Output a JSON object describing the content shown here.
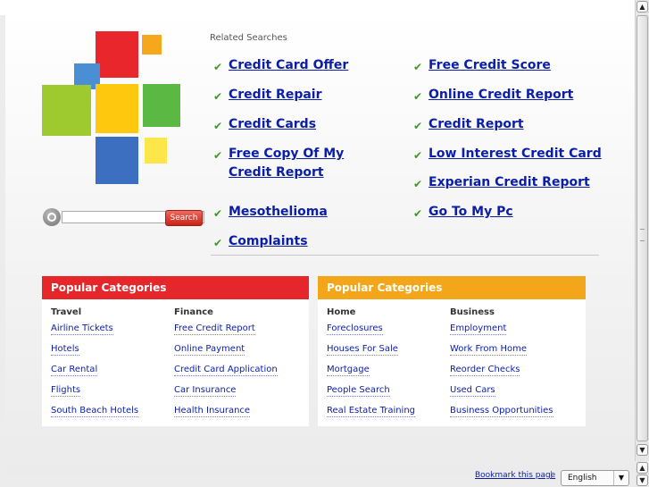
{
  "related": {
    "title": "Related Searches",
    "left": [
      "Credit Card Offer",
      "Credit Repair",
      "Credit Cards",
      "Free Copy Of My Credit Report",
      "Mesothelioma",
      "Complaints"
    ],
    "right": [
      "Free Credit Score",
      "Online Credit Report",
      "Credit Report",
      "Low Interest Credit Card",
      "Experian Credit Report",
      "Go To My Pc"
    ]
  },
  "search": {
    "button_label": "Search",
    "value": ""
  },
  "categories": [
    {
      "title": "Popular Categories",
      "color": "#e5272b",
      "columns": [
        {
          "heading": "Travel",
          "links": [
            "Airline Tickets",
            "Hotels",
            "Car Rental",
            "Flights",
            "South Beach Hotels"
          ]
        },
        {
          "heading": "Finance",
          "links": [
            "Free Credit Report",
            "Online Payment",
            "Credit Card Application",
            "Car Insurance",
            "Health Insurance"
          ]
        }
      ]
    },
    {
      "title": "Popular Categories",
      "color": "#f4a61a",
      "columns": [
        {
          "heading": "Home",
          "links": [
            "Foreclosures",
            "Houses For Sale",
            "Mortgage",
            "People Search",
            "Real Estate Training"
          ]
        },
        {
          "heading": "Business",
          "links": [
            "Employment",
            "Work From Home",
            "Reorder Checks",
            "Used Cars",
            "Business Opportunities"
          ]
        }
      ]
    }
  ],
  "footer": {
    "bookmark": "Bookmark this page",
    "separator": "|",
    "language": "English"
  },
  "icons": {
    "check": "check-icon",
    "search": "magnifier-icon",
    "arrow_up": "arrow-up-icon",
    "arrow_down": "arrow-down-icon"
  }
}
